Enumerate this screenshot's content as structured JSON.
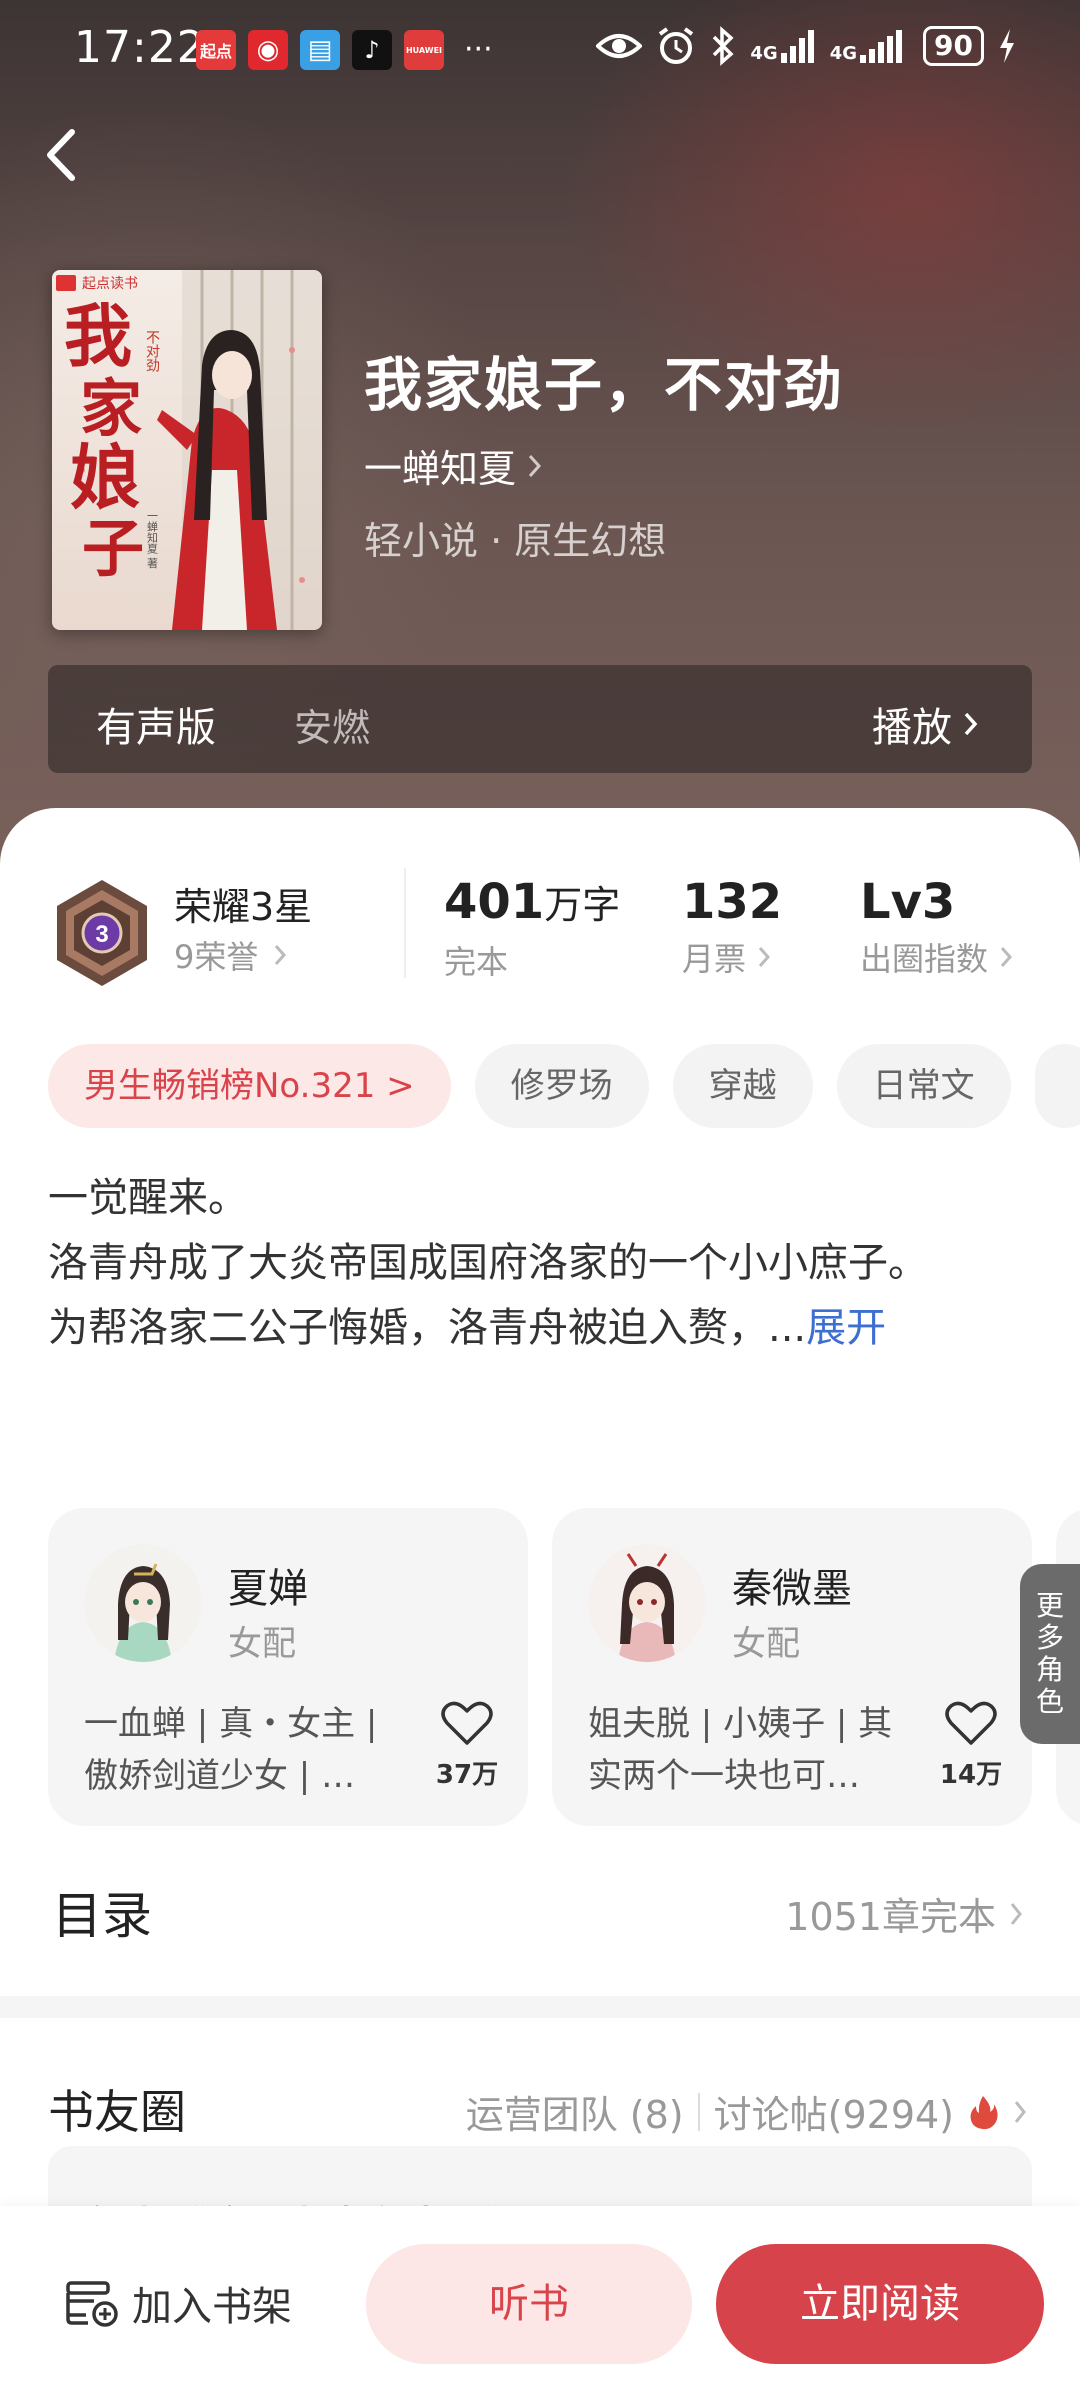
{
  "status_bar": {
    "time": "17:22",
    "battery": "90",
    "signal1": "4G",
    "signal2": "4G",
    "notification_apps": [
      {
        "icon": "qidian-app-icon",
        "color": "#e53a3a",
        "label": "起点"
      },
      {
        "icon": "netease-music-icon",
        "color": "#e0282e",
        "label": "◉"
      },
      {
        "icon": "book-app-icon",
        "color": "#3aa0e6",
        "label": "▤"
      },
      {
        "icon": "tiktok-icon",
        "color": "#111111",
        "label": "♪"
      },
      {
        "icon": "huawei-icon",
        "color": "#e03c3c",
        "label": "HUAWEI"
      }
    ],
    "more": "···"
  },
  "book": {
    "title": "我家娘子，不对劲",
    "author": "一蝉知夏",
    "genre": "轻小说 · 原生幻想",
    "cover_publisher": "起点读书",
    "cover_title": "我家娘子",
    "cover_subtitle": "不对劲",
    "cover_author": "一蝉知夏 著"
  },
  "audio": {
    "label": "有声版",
    "narrator": "安燃",
    "play_label": "播放"
  },
  "honor": {
    "title": "荣耀3星",
    "sub": "9荣誉",
    "level": "3"
  },
  "stats": [
    {
      "num": "401",
      "unit": "万字",
      "label": "完本"
    },
    {
      "num": "132",
      "unit": "",
      "label": "月票"
    },
    {
      "num": "Lv3",
      "unit": "",
      "label": "出圈指数"
    }
  ],
  "tags": [
    "男生畅销榜No.321 >",
    "修罗场",
    "穿越",
    "日常文"
  ],
  "intro": {
    "line1": "一觉醒来。",
    "line2": "洛青舟成了大炎帝国成国府洛家的一个小小庶子。",
    "line3": "为帮洛家二公子悔婚，洛青舟被迫入赘，...",
    "expand": "展开"
  },
  "roles": [
    {
      "name": "夏婵",
      "type": "女配",
      "desc": "一血蝉 | 真・女主 | 傲娇剑道少女 | …",
      "likes": "37万"
    },
    {
      "name": "秦微墨",
      "type": "女配",
      "desc": "姐夫脱 | 小姨子 | 其实两个一块也可…",
      "likes": "14万"
    }
  ],
  "more_roles": "更多角色",
  "toc": {
    "title": "目录",
    "info": "1051章完本"
  },
  "circle": {
    "title": "书友圈",
    "team": "运营团队 (8)",
    "posts": "讨论帖(9294)",
    "preview": "新书《这个书生有点猖》"
  },
  "bottom": {
    "shelf": "加入书架",
    "listen": "听书",
    "read": "立即阅读"
  },
  "colors": {
    "accent": "#d7434a",
    "accent_light": "#fce6e6",
    "link": "#3c6fd1"
  }
}
